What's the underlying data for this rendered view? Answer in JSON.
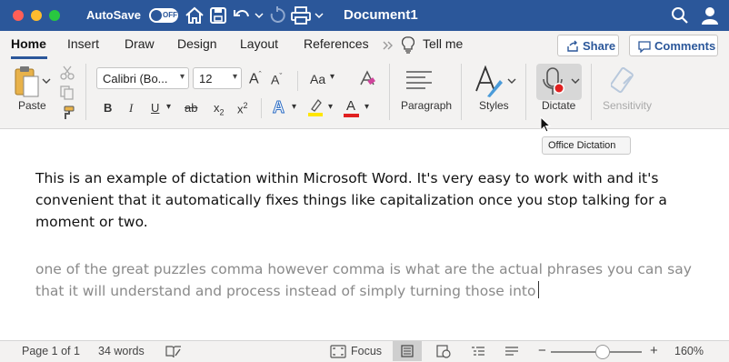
{
  "titlebar": {
    "autosave_label": "AutoSave",
    "autosave_state": "OFF",
    "document_title": "Document1"
  },
  "tabs": {
    "items": [
      "Home",
      "Insert",
      "Draw",
      "Design",
      "Layout",
      "References"
    ],
    "tell_me": "Tell me",
    "share_label": "Share",
    "comments_label": "Comments"
  },
  "ribbon": {
    "paste_label": "Paste",
    "font_name": "Calibri (Bo...",
    "font_size": "12",
    "grow_font": "A",
    "shrink_font": "A",
    "change_case": "Aa",
    "bold": "B",
    "italic": "I",
    "underline": "U",
    "strikethrough": "ab",
    "subscript": "x",
    "subscript_mark": "2",
    "superscript": "x",
    "superscript_mark": "2",
    "text_effects": "A",
    "font_color": "A",
    "paragraph_label": "Paragraph",
    "styles_label": "Styles",
    "dictate_label": "Dictate",
    "sensitivity_label": "Sensitivity"
  },
  "tooltip": {
    "text": "Office Dictation"
  },
  "document": {
    "paragraph1": "This is an example of dictation within Microsoft Word. It's very easy to work with and it's convenient that it automatically fixes things like capitalization once you stop talking for a moment or two.",
    "paragraph2": "one of the great puzzles comma however comma is what are the actual phrases you can say that it will understand and process instead of simply turning those into"
  },
  "statusbar": {
    "page": "Page 1 of 1",
    "words": "34 words",
    "focus": "Focus",
    "zoom_minus": "−",
    "zoom_plus": "+",
    "zoom": "160%",
    "zoom_level_fraction": 0.5
  },
  "colors": {
    "titlebar": "#2b579a",
    "accent": "#2b579a",
    "highlight": "#ffe600",
    "font_color": "#e02020",
    "dictate_record": "#e02020"
  }
}
